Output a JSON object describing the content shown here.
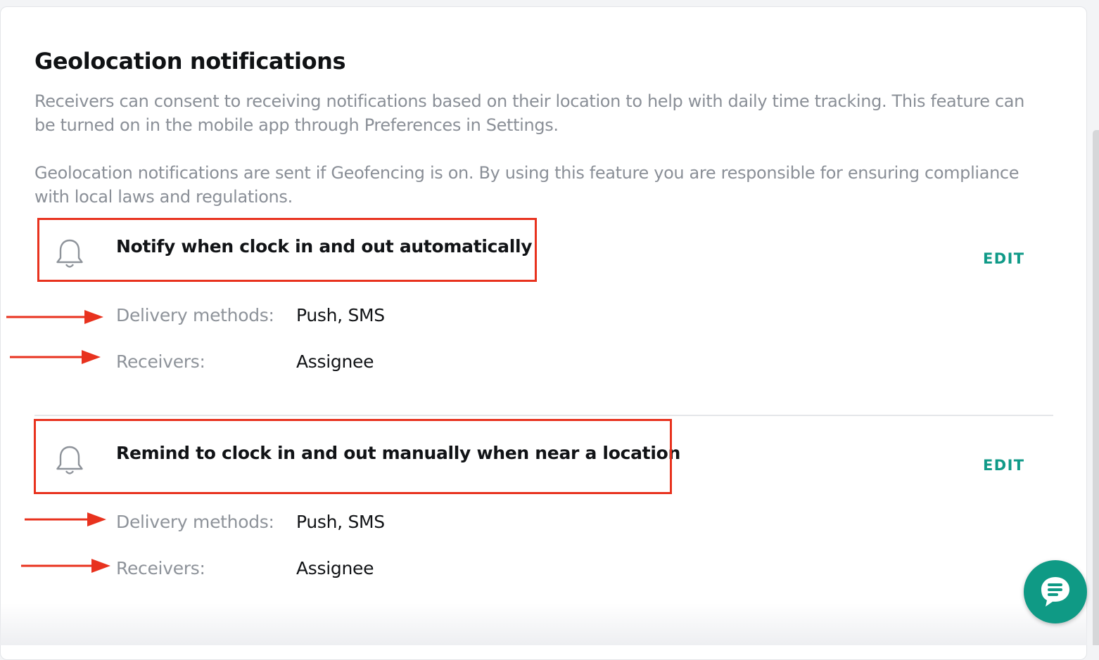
{
  "section": {
    "title": "Geolocation notifications",
    "description_1": "Receivers can consent to receiving notifications based on their location to help with daily time tracking. This feature can be turned on in the mobile app through Preferences in Settings.",
    "description_2": "Geolocation notifications are sent if Geofencing is on. By using this feature you are responsible for ensuring compliance with local laws and regulations."
  },
  "notifications": [
    {
      "icon": "bell-icon",
      "title": "Notify when clock in and out automatically",
      "edit_label": "EDIT",
      "delivery_label": "Delivery methods:",
      "delivery_value": "Push, SMS",
      "receivers_label": "Receivers:",
      "receivers_value": "Assignee"
    },
    {
      "icon": "bell-icon",
      "title": "Remind to clock in and out manually when near a location",
      "edit_label": "EDIT",
      "delivery_label": "Delivery methods:",
      "delivery_value": "Push, SMS",
      "receivers_label": "Receivers:",
      "receivers_value": "Assignee"
    }
  ],
  "chat_widget": {
    "icon": "chat-bubble-icon"
  },
  "colors": {
    "accent": "#109a88",
    "annotation": "#e8321e",
    "muted_text": "#8a8f97"
  }
}
